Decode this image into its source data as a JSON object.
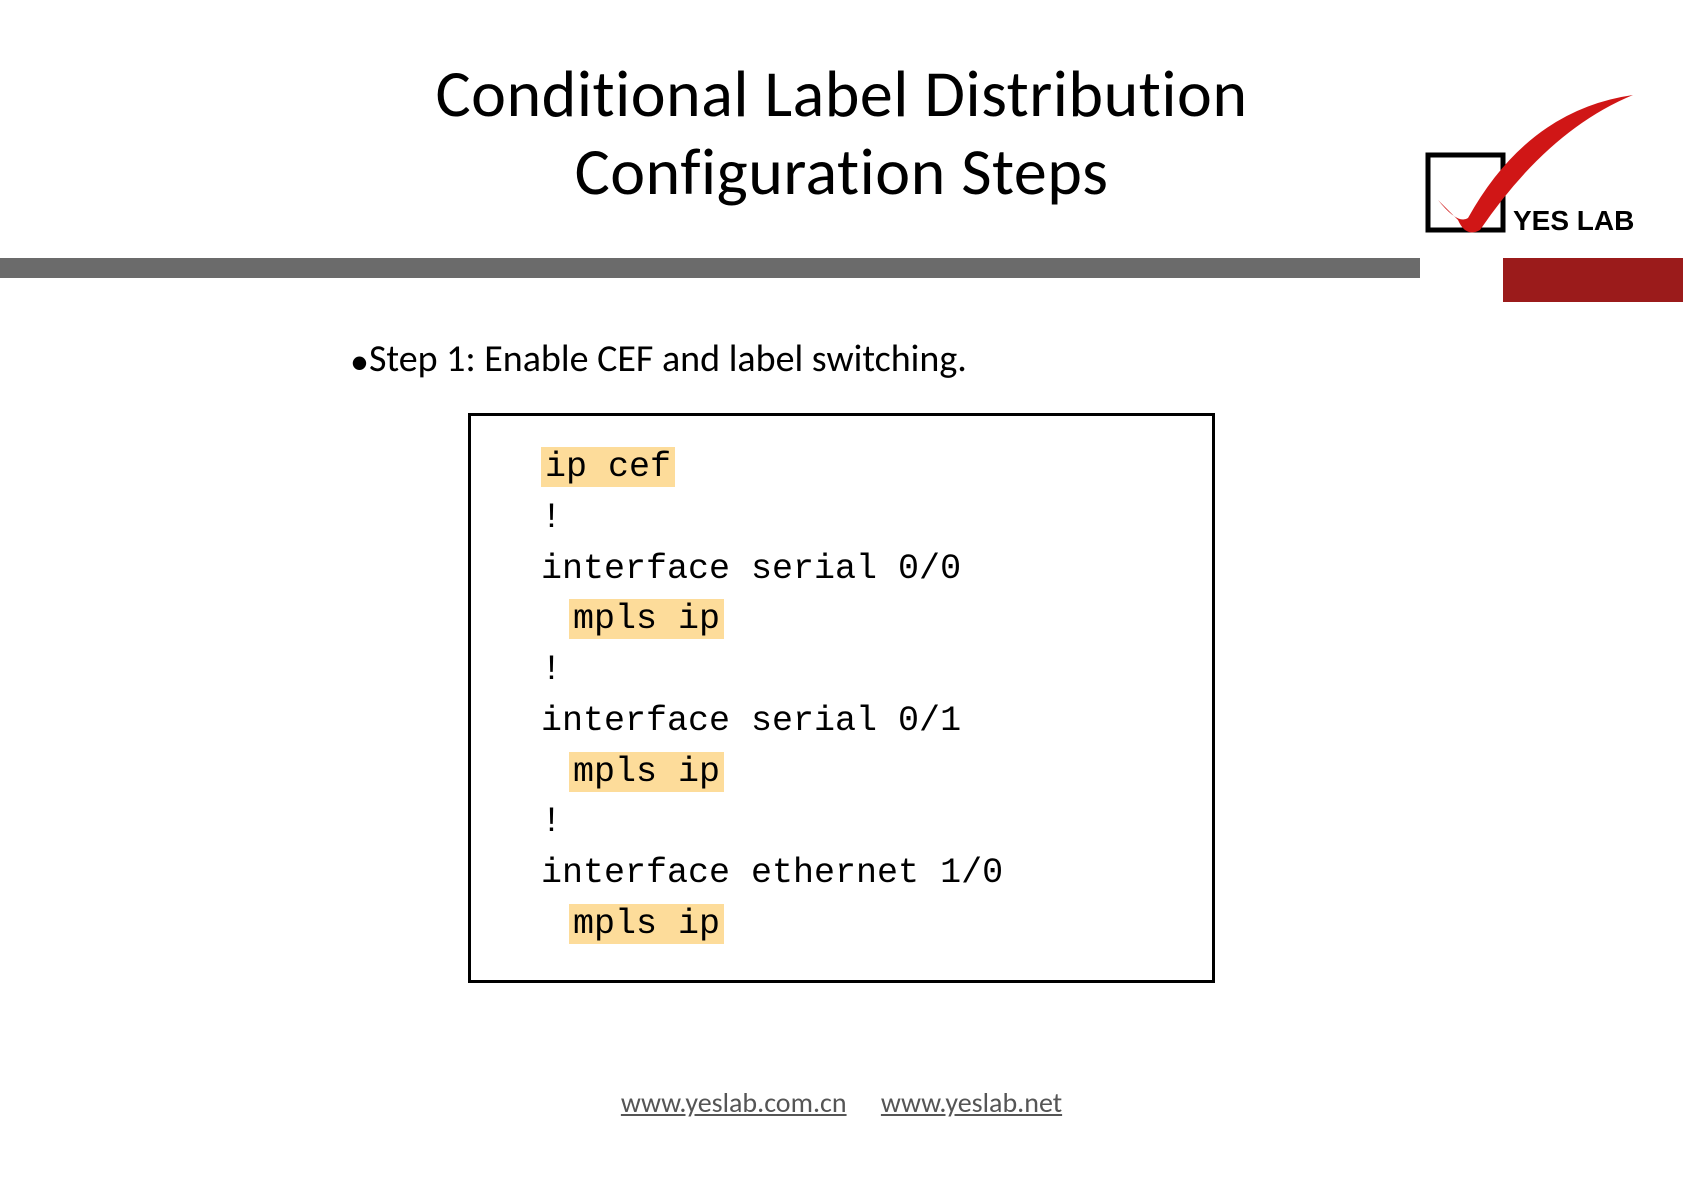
{
  "title": {
    "line1": "Conditional Label Distribution",
    "line2": "Configuration Steps"
  },
  "logo": {
    "text": "YES LAB"
  },
  "step": "Step 1: Enable CEF and label switching.",
  "code": {
    "l1": "ip cef",
    "l2": "!",
    "l3a": "interface",
    "l3b": " serial 0/0",
    "l4": "mpls ip",
    "l5": "!",
    "l6a": "interface",
    "l6b": " serial 0/1",
    "l7": "mpls ip",
    "l8": "!",
    "l9a": "interface",
    "l9b": " ethernet 1/0",
    "l10": "mpls ip"
  },
  "footer": {
    "link1": "www.yeslab.com.cn",
    "link2": "www.yeslab.net"
  }
}
